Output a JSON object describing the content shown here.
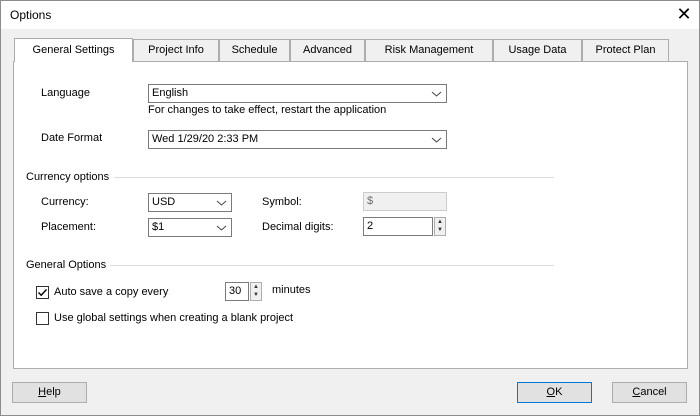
{
  "window": {
    "title": "Options"
  },
  "tabs": [
    {
      "label": "General Settings",
      "active": true
    },
    {
      "label": "Project Info"
    },
    {
      "label": "Schedule"
    },
    {
      "label": "Advanced"
    },
    {
      "label": "Risk Management"
    },
    {
      "label": "Usage Data"
    },
    {
      "label": "Protect Plan"
    }
  ],
  "language": {
    "label": "Language",
    "value": "English",
    "hint": "For changes to take effect, restart the application"
  },
  "date_format": {
    "label": "Date Format",
    "value": "Wed 1/29/20 2:33 PM"
  },
  "currency_options": {
    "heading": "Currency options",
    "currency_label": "Currency:",
    "currency_value": "USD",
    "symbol_label": "Symbol:",
    "symbol_value": "$",
    "placement_label": "Placement:",
    "placement_value": "$1",
    "decimal_label": "Decimal digits:",
    "decimal_value": "2"
  },
  "general_options": {
    "heading": "General Options",
    "autosave_label": "Auto save a copy every",
    "autosave_checked": true,
    "autosave_minutes": "30",
    "minutes_label": "minutes",
    "global_label": "Use global settings when creating a blank project",
    "global_checked": false
  },
  "buttons": {
    "help_first": "H",
    "help_rest": "elp",
    "ok_first": "O",
    "ok_rest": "K",
    "cancel_first": "C",
    "cancel_rest": "ancel"
  },
  "icons": {
    "close": "close-icon",
    "dropdown": "chevron-down-icon",
    "check": "checkmark-icon",
    "spin_up": "spin-up-arrow-icon",
    "spin_down": "spin-down-arrow-icon"
  }
}
